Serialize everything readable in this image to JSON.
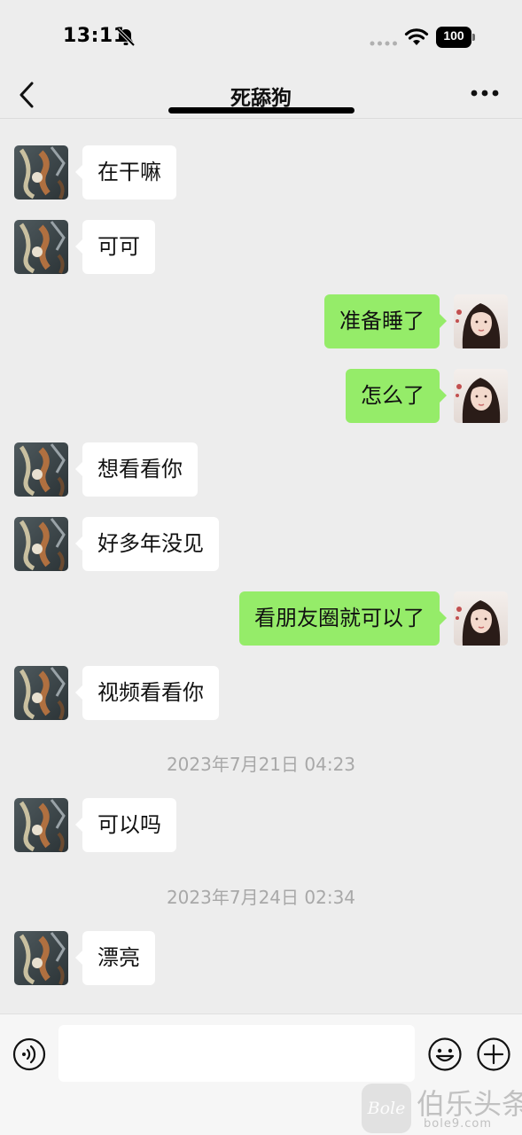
{
  "status_bar": {
    "time": "13:11",
    "battery": "100"
  },
  "header": {
    "title": "死舔狗"
  },
  "messages": [
    {
      "side": "left",
      "text": "在干嘛"
    },
    {
      "side": "left",
      "text": "可可"
    },
    {
      "side": "right",
      "text": "准备睡了"
    },
    {
      "side": "right",
      "text": "怎么了"
    },
    {
      "side": "left",
      "text": "想看看你"
    },
    {
      "side": "left",
      "text": "好多年没见"
    },
    {
      "side": "right",
      "text": "看朋友圈就可以了"
    },
    {
      "side": "left",
      "text": "视频看看你"
    },
    {
      "timestamp": "2023年7月21日 04:23"
    },
    {
      "side": "left",
      "text": "可以吗"
    },
    {
      "timestamp": "2023年7月24日 02:34"
    },
    {
      "side": "left",
      "text": "漂亮"
    }
  ],
  "input": {
    "value": "",
    "placeholder": ""
  },
  "watermark": {
    "text": "伯乐头条",
    "logo": "Bole",
    "sub": "bole9.com"
  },
  "colors": {
    "background": "#ededed",
    "bubble_sent": "#95ec69",
    "bubble_received": "#ffffff",
    "timestamp": "#a8a8a8"
  },
  "icons": {
    "status": [
      "bell-slash-icon",
      "signal-dots-icon",
      "wifi-icon",
      "battery-icon"
    ],
    "header": [
      "back-chevron-icon",
      "more-icon"
    ],
    "input_bar": [
      "voice-icon",
      "emoji-icon",
      "plus-icon"
    ],
    "avatars": [
      "contact-avatar",
      "self-avatar"
    ]
  }
}
